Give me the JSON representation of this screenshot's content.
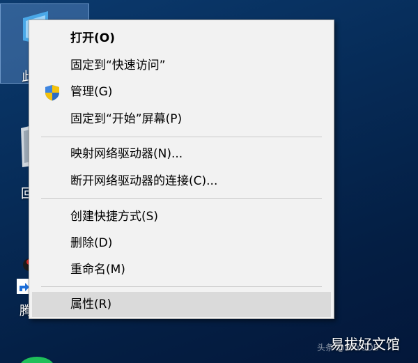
{
  "desktop": {
    "icons": [
      {
        "label_fragment": "此"
      },
      {
        "label_fragment": "回"
      },
      {
        "label_fragment": "腾"
      }
    ]
  },
  "context_menu": {
    "items": [
      {
        "label": "打开(O)",
        "bold": true
      },
      {
        "label": "固定到“快速访问”"
      },
      {
        "label": "管理(G)",
        "icon": "uac-shield-icon"
      },
      {
        "label": "固定到“开始”屏幕(P)"
      },
      {
        "label": "映射网络驱动器(N)..."
      },
      {
        "label": "断开网络驱动器的连接(C)..."
      },
      {
        "label": "创建快捷方式(S)"
      },
      {
        "label": "删除(D)"
      },
      {
        "label": "重命名(M)"
      },
      {
        "label": "属性(R)",
        "highlighted": true
      }
    ]
  },
  "watermark": {
    "text": "易拔好文馆",
    "small_text": "头条 @BAYUDB"
  },
  "colors": {
    "desktop_background": "#062b57",
    "menu_background": "#f2f2f2",
    "menu_hover": "#dadada",
    "separator": "#c8c8c8",
    "shield_blue": "#2b6cc4",
    "shield_yellow": "#f4c20d"
  }
}
